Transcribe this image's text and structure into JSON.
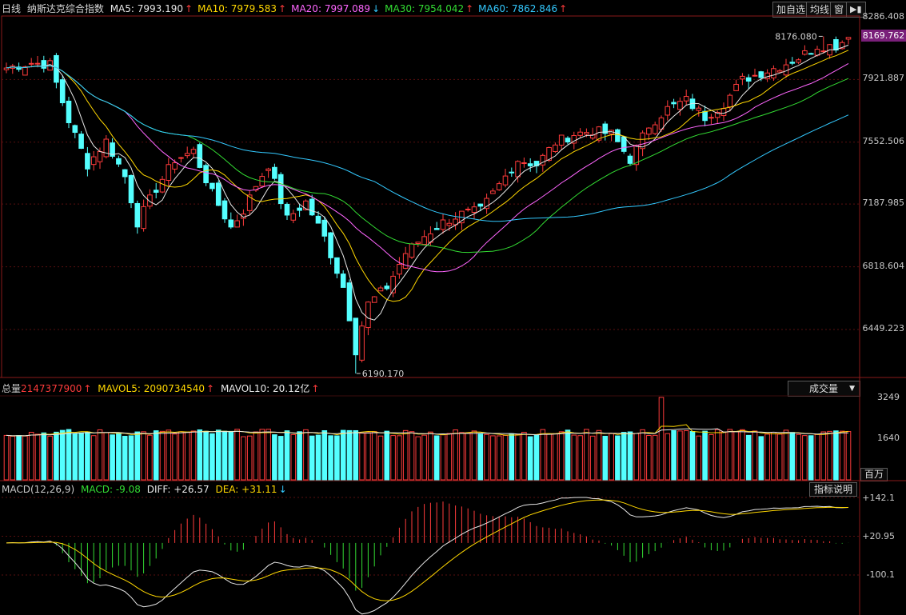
{
  "header": {
    "period": "日线",
    "index_name": "纳斯达克综合指数",
    "ma": [
      {
        "label": "MA5",
        "value": "7993.190",
        "dir": "up",
        "color": "#e8e8e8"
      },
      {
        "label": "MA10",
        "value": "7979.583",
        "dir": "up",
        "color": "#ffd700"
      },
      {
        "label": "MA20",
        "value": "7997.089",
        "dir": "down",
        "color": "#ff66ff"
      },
      {
        "label": "MA30",
        "value": "7954.042",
        "dir": "up",
        "color": "#33dd33"
      },
      {
        "label": "MA60",
        "value": "7862.846",
        "dir": "up",
        "color": "#33c9ff"
      }
    ],
    "buttons": {
      "add_watch": "加自选",
      "ma_line": "均线",
      "window": "窗"
    }
  },
  "price_axis": {
    "ticks": [
      "8286.408",
      "7921.887",
      "7552.506",
      "7187.985",
      "6818.604",
      "6449.223"
    ],
    "current": "8169.762",
    "high_label": "8176.080",
    "low_label": "6190.170"
  },
  "volume": {
    "total_label": "总量",
    "total_value": "2147377900",
    "mavol5_label": "MAVOL5",
    "mavol5_value": "2090734540",
    "mavol10_label": "MAVOL10",
    "mavol10_value": "20.12亿",
    "selector": "成交量",
    "ticks": [
      "3249",
      "1640"
    ],
    "unit": "百万"
  },
  "macd": {
    "title": "MACD(12,26,9)",
    "macd_label": "MACD",
    "macd_value": "-9.08",
    "diff_label": "DIFF",
    "diff_value": "+26.57",
    "dea_label": "DEA",
    "dea_value": "+31.11",
    "help_button": "指标说明",
    "ticks": [
      "+142.1",
      "+20.95",
      "-100.1"
    ]
  },
  "chart_data": {
    "type": "candlestick",
    "title": "纳斯达克综合指数 日线",
    "price_range": [
      6190.17,
      8286.408
    ],
    "price_keypoints": [
      {
        "i": 0,
        "c": 7990
      },
      {
        "i": 4,
        "c": 8020
      },
      {
        "i": 7,
        "c": 8010
      },
      {
        "i": 10,
        "c": 7680
      },
      {
        "i": 13,
        "c": 7420
      },
      {
        "i": 16,
        "c": 7560
      },
      {
        "i": 19,
        "c": 7350
      },
      {
        "i": 21,
        "c": 7080
      },
      {
        "i": 24,
        "c": 7280
      },
      {
        "i": 27,
        "c": 7450
      },
      {
        "i": 30,
        "c": 7500
      },
      {
        "i": 33,
        "c": 7250
      },
      {
        "i": 36,
        "c": 7050
      },
      {
        "i": 38,
        "c": 7150
      },
      {
        "i": 40,
        "c": 7300
      },
      {
        "i": 42,
        "c": 7420
      },
      {
        "i": 45,
        "c": 7100
      },
      {
        "i": 48,
        "c": 7200
      },
      {
        "i": 51,
        "c": 6990
      },
      {
        "i": 54,
        "c": 6700
      },
      {
        "i": 56,
        "c": 6350
      },
      {
        "i": 58,
        "c": 6600
      },
      {
        "i": 61,
        "c": 6700
      },
      {
        "i": 64,
        "c": 6900
      },
      {
        "i": 67,
        "c": 7000
      },
      {
        "i": 70,
        "c": 7080
      },
      {
        "i": 73,
        "c": 7130
      },
      {
        "i": 76,
        "c": 7150
      },
      {
        "i": 79,
        "c": 7300
      },
      {
        "i": 82,
        "c": 7450
      },
      {
        "i": 85,
        "c": 7420
      },
      {
        "i": 88,
        "c": 7550
      },
      {
        "i": 91,
        "c": 7600
      },
      {
        "i": 94,
        "c": 7620
      },
      {
        "i": 97,
        "c": 7600
      },
      {
        "i": 100,
        "c": 7450
      },
      {
        "i": 103,
        "c": 7650
      },
      {
        "i": 106,
        "c": 7750
      },
      {
        "i": 109,
        "c": 7800
      },
      {
        "i": 112,
        "c": 7700
      },
      {
        "i": 115,
        "c": 7780
      },
      {
        "i": 118,
        "c": 7920
      },
      {
        "i": 121,
        "c": 7960
      },
      {
        "i": 124,
        "c": 8000
      },
      {
        "i": 127,
        "c": 8050
      },
      {
        "i": 130,
        "c": 8120
      },
      {
        "i": 133,
        "c": 8120
      },
      {
        "i": 135,
        "c": 8170
      }
    ],
    "volume_range": [
      0,
      3249
    ],
    "macd_range": [
      -100.1,
      142.1
    ]
  }
}
